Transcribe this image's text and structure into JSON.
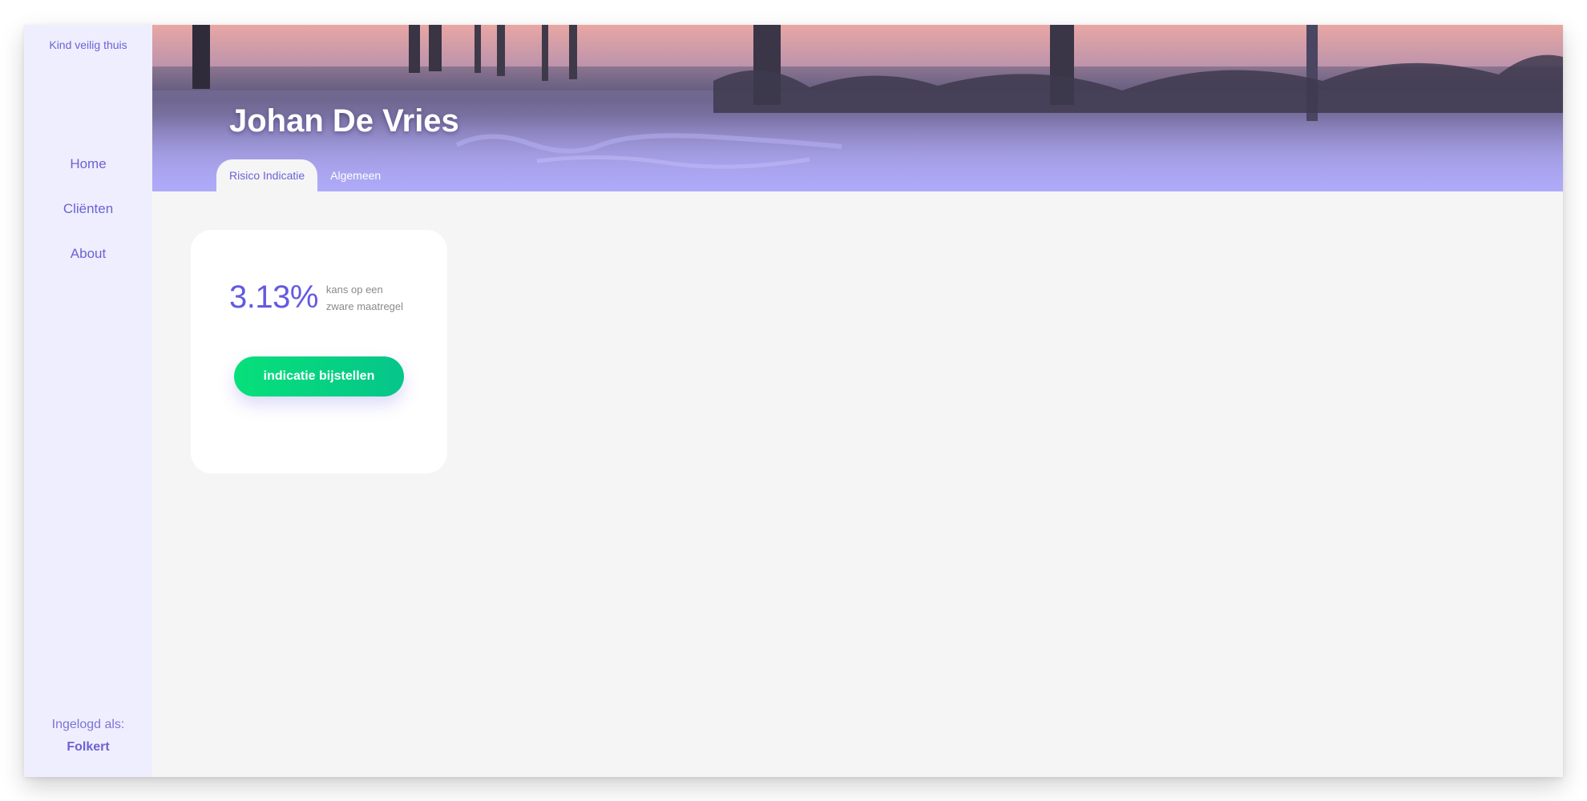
{
  "sidebar": {
    "brand": "Kind veilig thuis",
    "nav": [
      {
        "label": "Home"
      },
      {
        "label": "Cliënten"
      },
      {
        "label": "About"
      }
    ],
    "login_label": "Ingelogd als:",
    "login_user": "Folkert"
  },
  "header": {
    "title": "Johan De Vries",
    "tabs": [
      {
        "label": "Risico Indicatie",
        "active": true
      },
      {
        "label": "Algemeen",
        "active": false
      }
    ]
  },
  "risk_card": {
    "value": "3.13%",
    "description_line1": "kans op een",
    "description_line2": "zware maatregel",
    "button_label": "indicatie bijstellen"
  },
  "colors": {
    "accent": "#6b63d4",
    "sidebar_bg": "#efeefe",
    "button_green": "#07e07a",
    "content_bg": "#f5f5f6"
  }
}
